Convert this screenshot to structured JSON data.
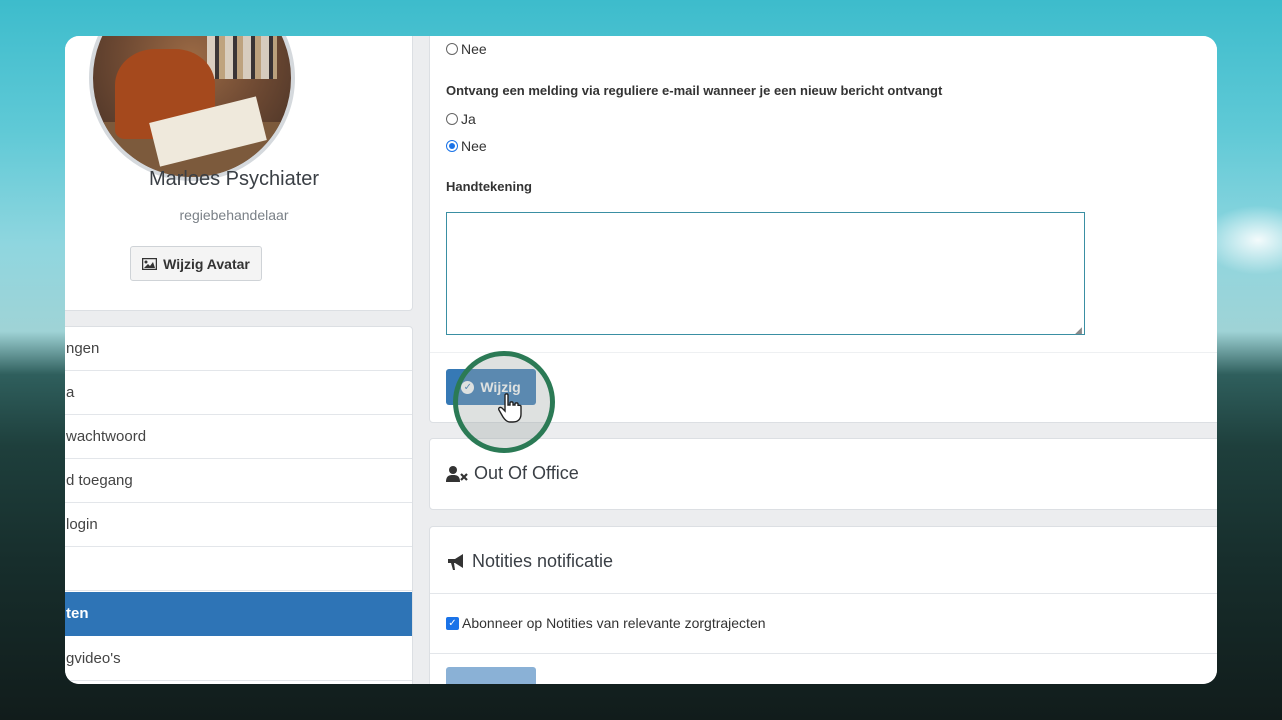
{
  "profile": {
    "name": "Marloes Psychiater",
    "role": "regiebehandelaar",
    "avatar_button_label": "Wijzig Avatar"
  },
  "menu": {
    "items": [
      {
        "label": "ngen"
      },
      {
        "label": "a"
      },
      {
        "label": "wachtwoord"
      },
      {
        "label": "d toegang"
      },
      {
        "label": "login"
      },
      {
        "label": ""
      },
      {
        "label": "ten",
        "active": true
      },
      {
        "label": "gvideo's"
      }
    ]
  },
  "settings": {
    "top_option_label": "Nee",
    "email_question": "Ontvang een melding via reguliere e-mail wanneer je een nieuw bericht ontvangt",
    "option_yes": "Ja",
    "option_no": "Nee",
    "email_selected": "Nee",
    "signature_label": "Handtekening",
    "signature_value": "",
    "save_button_label": "Wijzig"
  },
  "out_of_office": {
    "title": "Out Of Office"
  },
  "notes_notification": {
    "title": "Notities notificatie",
    "subscribe_label": "Abonneer op Notities van relevante zorgtrajecten",
    "subscribe_checked": true
  },
  "colors": {
    "primary": "#3679b5",
    "active_menu": "#2e74b6",
    "click_ring": "#2b7a55"
  }
}
